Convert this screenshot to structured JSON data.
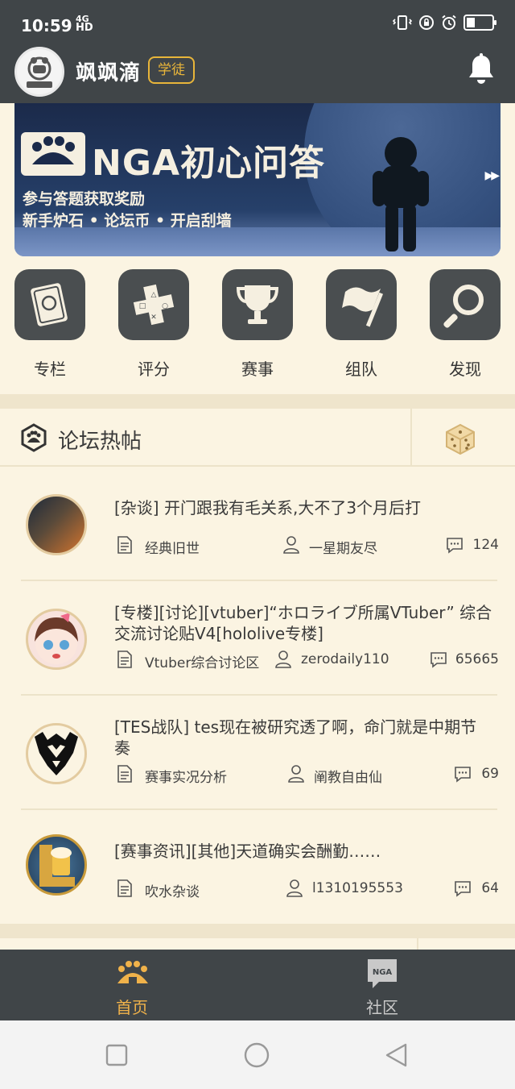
{
  "status_bar": {
    "time": "10:59",
    "network_top": "4G",
    "network_bottom": "HD"
  },
  "header": {
    "username": "飒飒滴",
    "rank_badge": "学徒",
    "avatar_text": "NGA.CN"
  },
  "banner": {
    "title": "NGA初心问答",
    "subtitle_line1": "参与答题获取奖励",
    "subtitle_line2": "新手炉石 • 论坛币 • 开启刮墙",
    "arrow_icon": "double-chevron-right-icon"
  },
  "quick_nav": [
    {
      "label": "专栏",
      "icon": "book-icon"
    },
    {
      "label": "评分",
      "icon": "gamepad-icon"
    },
    {
      "label": "赛事",
      "icon": "trophy-icon"
    },
    {
      "label": "组队",
      "icon": "flag-icon"
    },
    {
      "label": "发现",
      "icon": "magnifier-icon"
    }
  ],
  "hot_posts": {
    "title": "论坛热帖",
    "items": [
      {
        "title": "[杂谈] 开门跟我有毛关系,大不了3个月后打",
        "forum": "经典旧世",
        "author": "一星期友尽",
        "replies": "124"
      },
      {
        "title": "[专楼][讨论][vtuber]“ホロライブ所属VTuber” 综合交流讨论贴V4[hololive专楼]",
        "forum": "Vtuber综合讨论区",
        "author": "zerodaily110",
        "replies": "65665"
      },
      {
        "title": "[TES战队] tes现在被研究透了啊，命门就是中期节奏",
        "forum": "赛事实况分析",
        "author": "阐教自由仙",
        "replies": "69"
      },
      {
        "title": "[赛事资讯][其他]天道确实会酬勤……",
        "forum": "吹水杂谈",
        "author": "l1310195553",
        "replies": "64"
      }
    ]
  },
  "tabbar": {
    "home_label": "首页",
    "community_label": "社区",
    "community_badge": "NGA"
  },
  "colors": {
    "header_bg": "#404548",
    "page_bg": "#fbf4e2",
    "accent": "#f0b24a",
    "rank_border": "#e8b53a"
  }
}
